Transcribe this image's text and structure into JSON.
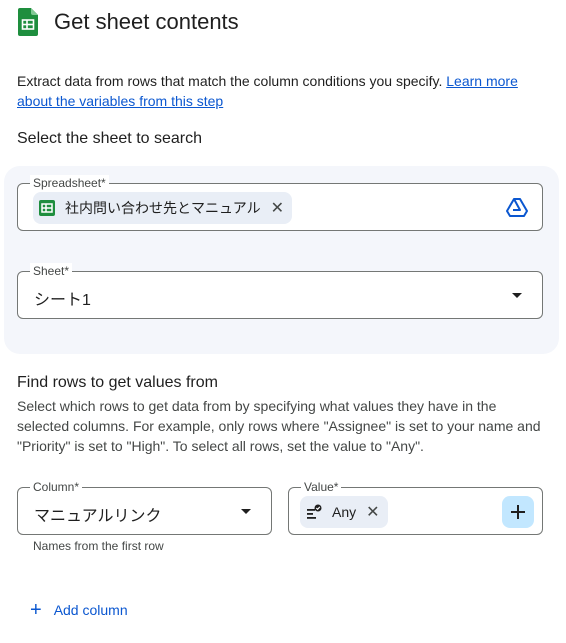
{
  "header": {
    "title": "Get sheet contents",
    "icon": "google-sheets-icon",
    "icon_color": "#1e8e3e"
  },
  "description": {
    "text": "Extract data from rows that match the column conditions you specify.",
    "link": "Learn more about the variables from this step"
  },
  "select_sheet": {
    "title": "Select the sheet to search",
    "spreadsheet": {
      "label": "Spreadsheet*",
      "value": "社内問い合わせ先とマニュアル",
      "icon": "drive-icon"
    },
    "sheet": {
      "label": "Sheet*",
      "value": "シート1"
    }
  },
  "find_rows": {
    "title": "Find rows to get values from",
    "description": "Select which rows to get data from by specifying what values they have in the selected columns. For example, only rows where \"Assignee\" is set to your name and \"Priority\" is set to \"High\". To select all rows, set the value to \"Any\".",
    "column": {
      "label": "Column*",
      "value": "マニュアルリンク",
      "hint": "Names from the first row"
    },
    "value": {
      "label": "Value*",
      "chip": "Any"
    },
    "add_column": "Add column"
  },
  "colors": {
    "accent": "#0b57d0",
    "panel_bg": "#f4f6fb",
    "chip_bg": "#e9eef6",
    "plus_bg": "#c2e7ff"
  }
}
